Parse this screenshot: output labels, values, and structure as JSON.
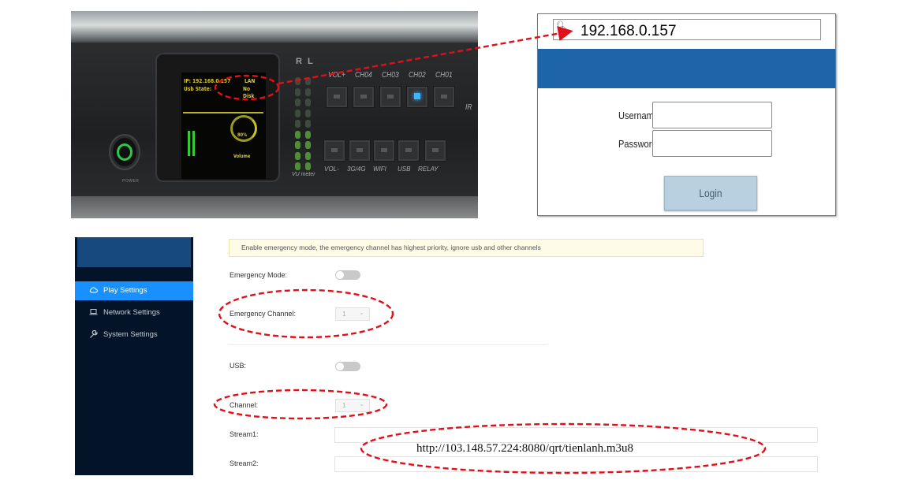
{
  "device": {
    "lcd_ip": "IP: 192.168.0.157",
    "lcd_lan": "LAN",
    "lcd_usb_state": "Usb State:",
    "lcd_no_disk": "No Disk",
    "lcd_volume_pct": "80%",
    "lcd_volume_label": "Volume",
    "power_label": "POWER",
    "vu_r": "R",
    "vu_l": "L",
    "vu_meter_label": "VU meter",
    "top_keys": [
      "VOL+",
      "CH04",
      "CH03",
      "CH02",
      "CH01"
    ],
    "bottom_keys": [
      "VOL-",
      "3G/4G",
      "WIFI",
      "USB",
      "RELAY"
    ],
    "ir_label": "IR"
  },
  "login": {
    "address": "192.168.0.157",
    "username_label": "Username",
    "password_label": "Password",
    "login_button": "Login",
    "header_color": "#1d65a8"
  },
  "admin": {
    "sidebar": {
      "items": [
        {
          "label": "Play Settings",
          "icon": "cloud-icon",
          "active": true
        },
        {
          "label": "Network Settings",
          "icon": "laptop-icon",
          "active": false
        },
        {
          "label": "System Settings",
          "icon": "wrench-icon",
          "active": false
        }
      ]
    },
    "notice": "Enable emergency mode, the emergency channel has highest priority, ignore usb and other channels",
    "emergency_mode_label": "Emergency Mode:",
    "emergency_mode_on": false,
    "emergency_channel_label": "Emergency Channel:",
    "emergency_channel_value": "1",
    "usb_label": "USB:",
    "usb_on": false,
    "channel_label": "Channel:",
    "channel_value": "1",
    "stream1_label": "Stream1:",
    "stream2_label": "Stream2:",
    "stream1_value": "http://103.148.57.224:8080/qrt/tienlanh.m3u8",
    "accent_color": "#1890ff"
  }
}
